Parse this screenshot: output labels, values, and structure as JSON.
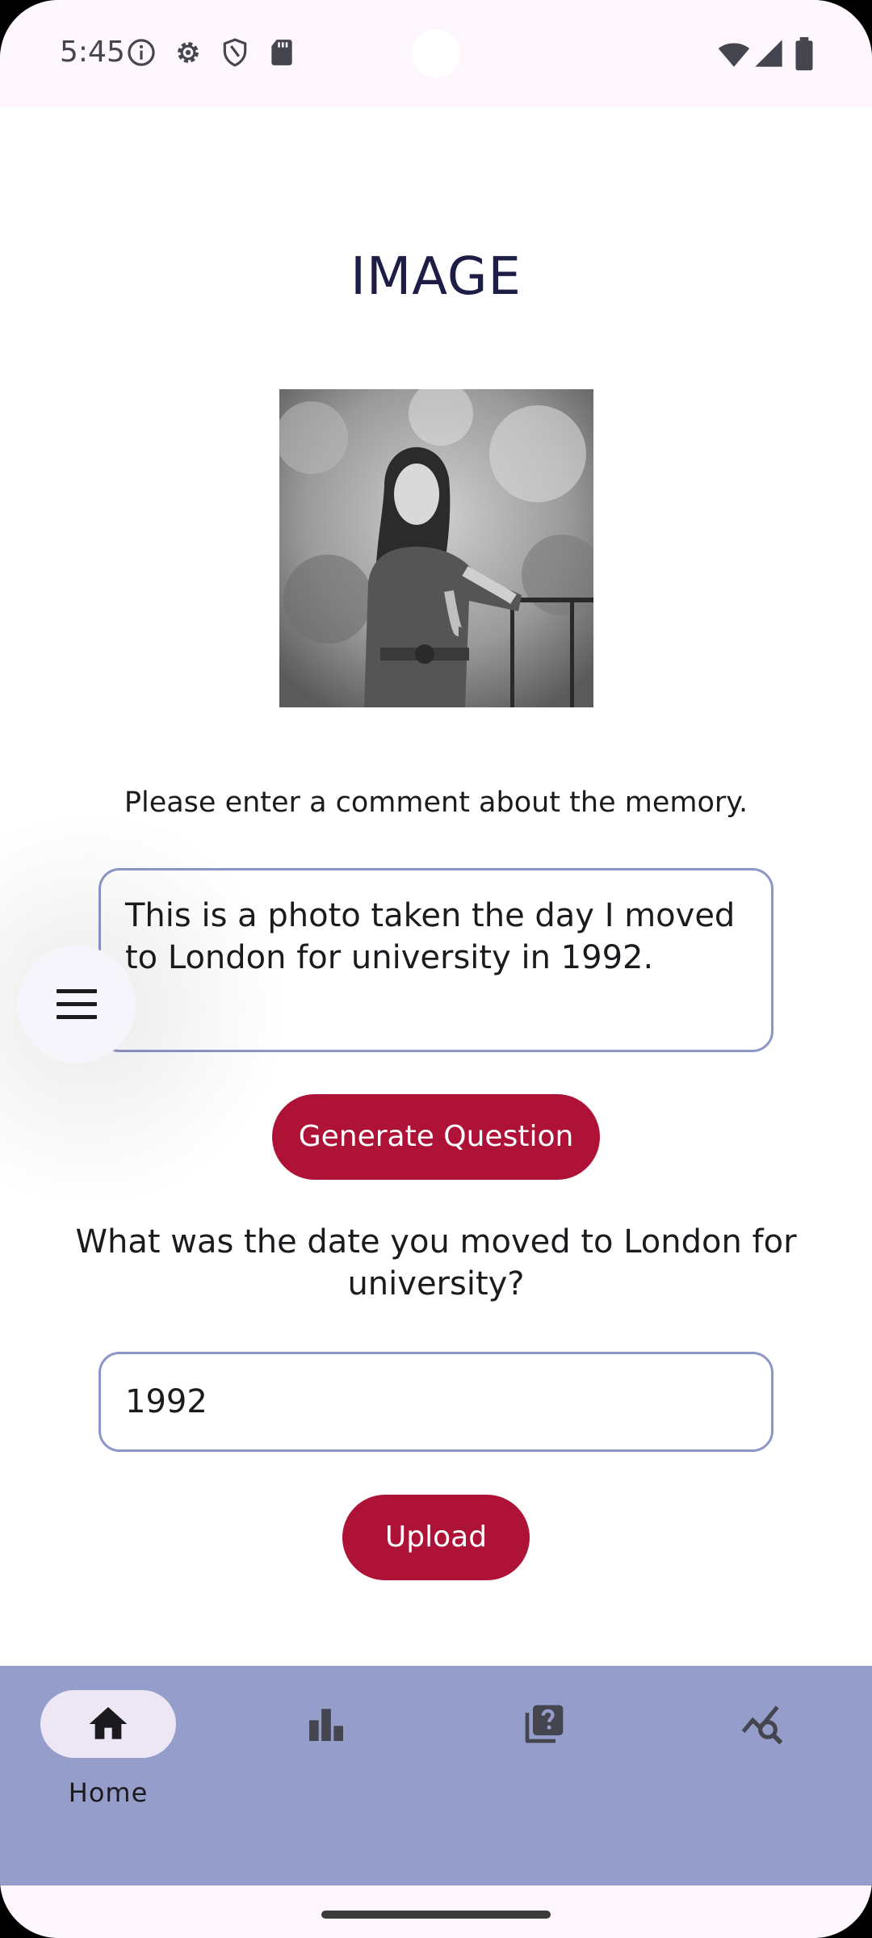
{
  "status_bar": {
    "time": "5:45",
    "left_icons": [
      "info-icon",
      "settings-gear-icon",
      "shield-icon",
      "sd-card-icon"
    ],
    "right_icons": [
      "wifi-icon",
      "signal-icon",
      "battery-icon"
    ]
  },
  "main": {
    "title": "IMAGE",
    "comment_prompt": "Please enter a comment about the memory.",
    "comment_value": "This is a photo taken the day I moved to London for university in 1992.",
    "generate_button_label": "Generate Question",
    "question_text": "What was the date you moved to London for university?",
    "answer_value": "1992",
    "upload_button_label": "Upload"
  },
  "floating_menu": {
    "icon": "menu-icon"
  },
  "bottom_nav": {
    "items": [
      {
        "label": "Home",
        "icon": "home-icon",
        "selected": true
      },
      {
        "label": "",
        "icon": "bar-chart-icon",
        "selected": false
      },
      {
        "label": "",
        "icon": "quiz-icon",
        "selected": false
      },
      {
        "label": "",
        "icon": "query-stats-icon",
        "selected": false
      }
    ]
  },
  "colors": {
    "accent_button": "#ae1237",
    "nav_background": "#959dcb",
    "field_border": "#8d96c6",
    "title_color": "#1e1d45"
  }
}
